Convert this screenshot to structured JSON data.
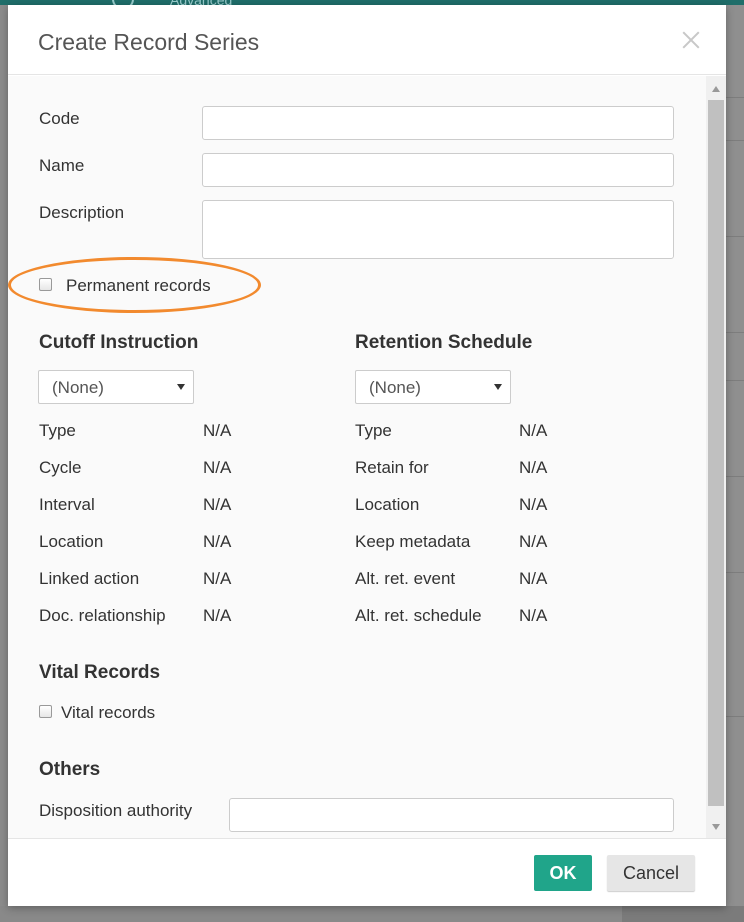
{
  "background": {
    "tab_label": "Advanced"
  },
  "dialog": {
    "title": "Create Record Series",
    "fields": {
      "code": {
        "label": "Code",
        "value": ""
      },
      "name": {
        "label": "Name",
        "value": ""
      },
      "description": {
        "label": "Description",
        "value": ""
      },
      "permanent_records": {
        "label": "Permanent records",
        "checked": false
      }
    },
    "cutoff": {
      "title": "Cutoff Instruction",
      "selected": "(None)",
      "rows": [
        {
          "label": "Type",
          "value": "N/A"
        },
        {
          "label": "Cycle",
          "value": "N/A"
        },
        {
          "label": "Interval",
          "value": "N/A"
        },
        {
          "label": "Location",
          "value": "N/A"
        },
        {
          "label": "Linked action",
          "value": "N/A"
        },
        {
          "label": "Doc. relationship",
          "value": "N/A"
        }
      ]
    },
    "retention": {
      "title": "Retention Schedule",
      "selected": "(None)",
      "rows": [
        {
          "label": "Type",
          "value": "N/A"
        },
        {
          "label": "Retain for",
          "value": "N/A"
        },
        {
          "label": "Location",
          "value": "N/A"
        },
        {
          "label": "Keep metadata",
          "value": "N/A"
        },
        {
          "label": "Alt. ret. event",
          "value": "N/A"
        },
        {
          "label": "Alt. ret. schedule",
          "value": "N/A"
        }
      ]
    },
    "vital": {
      "title": "Vital Records",
      "checkbox_label": "Vital records",
      "checked": false
    },
    "others": {
      "title": "Others",
      "disposition_label": "Disposition authority",
      "disposition_value": ""
    },
    "ok_label": "OK",
    "cancel_label": "Cancel"
  },
  "colors": {
    "accent": "#20a58a",
    "annotation": "#f28a2e",
    "header_bar": "#1f6e6a"
  }
}
